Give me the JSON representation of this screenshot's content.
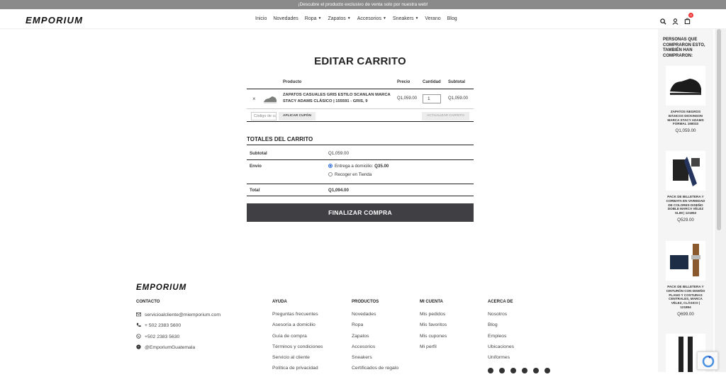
{
  "promo": {
    "text": "¡Descubre el producto exclusivo de venta solo por nuestra web!"
  },
  "header": {
    "logo": "EMPORIUM",
    "nav": [
      {
        "label": "Inicio",
        "caret": false
      },
      {
        "label": "Novedades",
        "caret": false
      },
      {
        "label": "Ropa",
        "caret": true
      },
      {
        "label": "Zapatos",
        "caret": true
      },
      {
        "label": "Accesorios",
        "caret": true
      },
      {
        "label": "Sneakers",
        "caret": true
      },
      {
        "label": "Verano",
        "caret": false
      },
      {
        "label": "Blog",
        "caret": false
      }
    ],
    "cart_count": "0"
  },
  "page": {
    "title": "EDITAR CARRITO"
  },
  "cart": {
    "headers": {
      "product": "Producto",
      "price": "Precio",
      "quantity": "Cantidad",
      "subtotal": "Subtotal"
    },
    "item": {
      "remove": "×",
      "name": "ZAPATOS CASUALES GRIS ESTILO SCANLAN MARCA STACY ADAMS CLÁSICO | 155591 - GRIS, 9",
      "price": "Q1,059.00",
      "quantity": "1",
      "subtotal": "Q1,059.00"
    },
    "coupon_placeholder": "Código de cupón",
    "apply_coupon": "APLICAR CUPÓN",
    "update_cart": "ACTUALIZAR CARRITO"
  },
  "totals": {
    "title": "TOTALES DEL CARRITO",
    "subtotal_label": "Subtotal",
    "subtotal_value": "Q1,059.00",
    "shipping_label": "Envío",
    "shipping_option_1": "Entrega a domicilio: ",
    "shipping_option_1_price": "Q35.00",
    "shipping_option_2": "Recoger en Tienda",
    "total_label": "Total",
    "total_value": "Q1,094.00"
  },
  "checkout_button": "FINALIZAR COMPRA",
  "sidebar": {
    "title": "PERSONAS QUE COMPRARON ESTO, TAMBIÉN HAN COMPRARON:",
    "items": [
      {
        "name": "ZAPATOS NEGROS BÁSICOS DICKINSON MARCA STACY ADAMS FORMAL 198033",
        "price": "Q1,059.00"
      },
      {
        "name": "PACK DE BILLETERA Y CORBATA EN VARIEDAD DE COLORES DISEÑO DOBLE MARCA VÉLEZ SLIM | 121853",
        "price": "Q529.00"
      },
      {
        "name": "PACK DE BILLETERA Y CINTURÓN CON DISEÑO PLANO Y COSTURAS CENTRALES, MARCA VÉLEZ, CLÁSICO | 121894",
        "price": "Q699.00"
      }
    ]
  },
  "footer": {
    "logo": "EMPORIUM",
    "contact": {
      "title": "CONTACTO",
      "items": [
        {
          "icon": "mail-icon",
          "text": "servicioalcliente@miemporium.com"
        },
        {
          "icon": "phone-icon",
          "text": "+ 502 2383 5600"
        },
        {
          "icon": "whatsapp-icon",
          "text": "+502 2383 5630"
        },
        {
          "icon": "messenger-icon",
          "text": "@EmporiumGuatemala"
        }
      ]
    },
    "help": {
      "title": "AYUDA",
      "items": [
        "Preguntas frecuentes",
        "Asesoría a domicilio",
        "Guía de compra",
        "Términos y condiciones",
        "Servicio al cliente",
        "Política de privacidad"
      ]
    },
    "products": {
      "title": "PRODUCTOS",
      "items": [
        "Novedades",
        "Ropa",
        "Zapatos",
        "Accesorios",
        "Sneakers",
        "Certificados de regalo"
      ]
    },
    "account": {
      "title": "MI CUENTA",
      "items": [
        "Mis pedidos",
        "Mis favoritos",
        "Mis cupones",
        "Mi perfil"
      ]
    },
    "about": {
      "title": "ACERCA DE",
      "items": [
        "Nosotros",
        "Blog",
        "Empleos",
        "Ubicaciones",
        "Uniformes"
      ]
    }
  },
  "colors": {
    "promo_bg": "#8a8a8a",
    "checkout_bg": "#3f3f44",
    "badge": "#e33333",
    "radio": "#2a6ad8"
  }
}
